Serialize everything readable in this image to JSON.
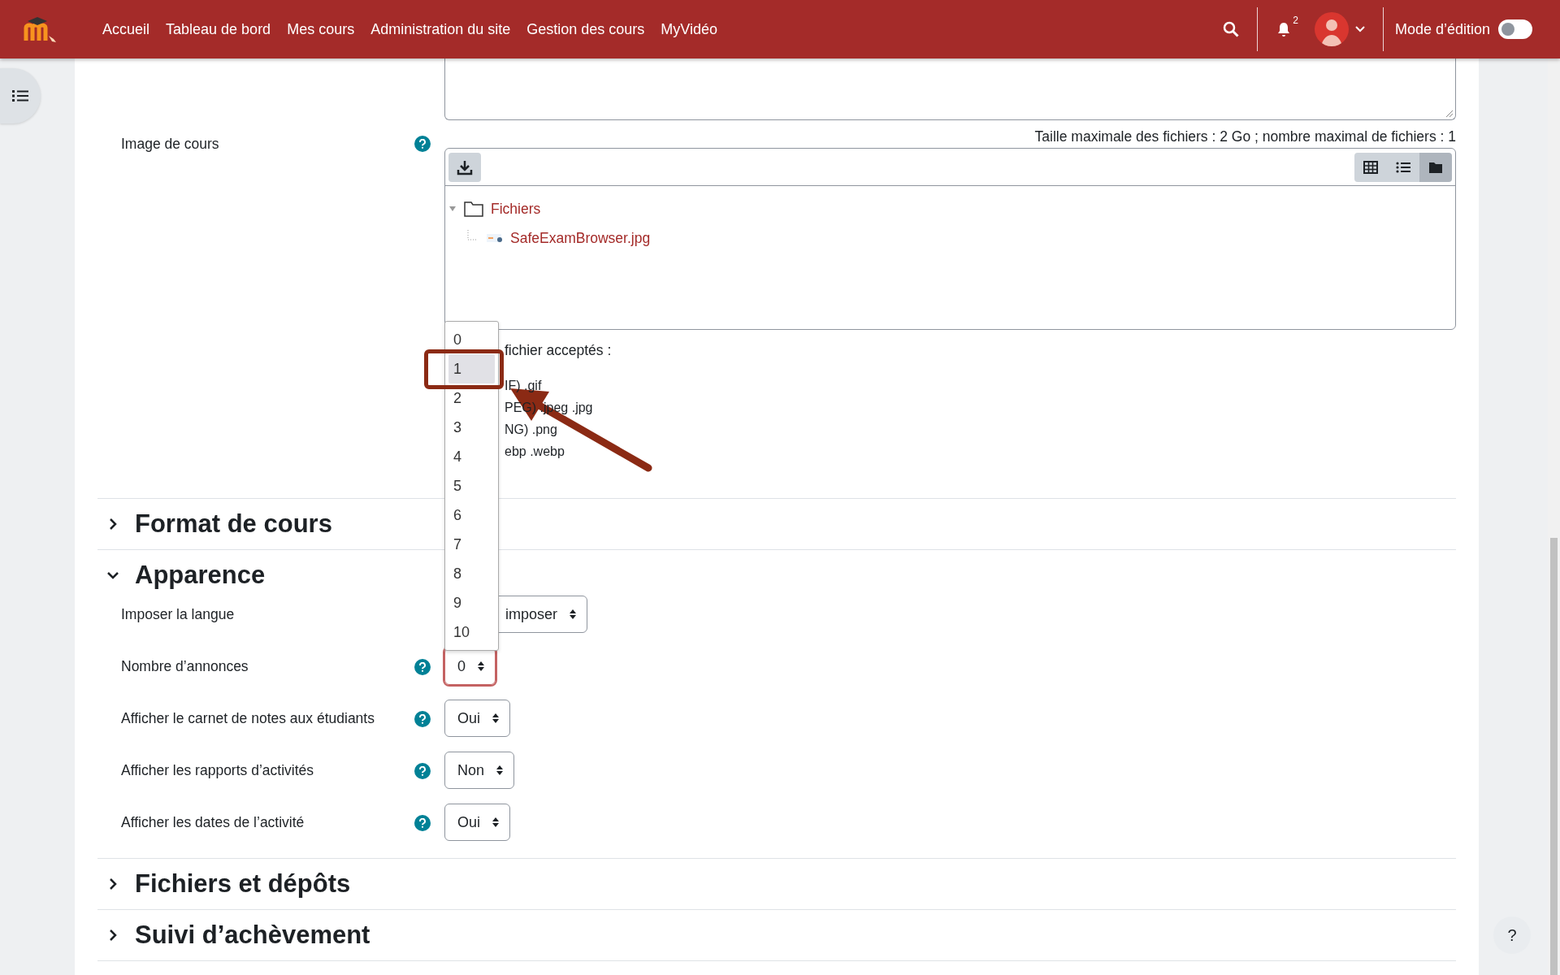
{
  "navbar": {
    "menu": [
      {
        "label": "Accueil"
      },
      {
        "label": "Tableau de bord"
      },
      {
        "label": "Mes cours"
      },
      {
        "label": "Administration du site"
      },
      {
        "label": "Gestion des cours"
      },
      {
        "label": "MyVidéo"
      }
    ],
    "notification_count": "2",
    "edit_mode": {
      "label": "Mode d’édition",
      "on": false
    }
  },
  "course_image": {
    "label": "Image de cours",
    "help": true,
    "max_info": "Taille maximale des fichiers : 2 Go ; nombre maximal de fichiers : 1",
    "views": [
      {
        "kind": "grid",
        "selected": false
      },
      {
        "kind": "list",
        "selected": false
      },
      {
        "kind": "tree",
        "selected": true
      }
    ],
    "tree": [
      {
        "name": "Fichiers",
        "expanded": true,
        "children": [
          {
            "name": "SafeExamBrowser.jpg"
          }
        ]
      }
    ],
    "accepted_types": [
      "fichier acceptés :",
      "IF) .gif",
      "PEG) .jpeg .jpg",
      "NG) .png",
      "ebp .webp"
    ]
  },
  "sections": [
    {
      "title": "Format de cours",
      "expanded": false
    },
    {
      "title": "Apparence",
      "expanded": true,
      "fields": [
        {
          "label": "Imposer la langue",
          "help": false,
          "value": "imposer",
          "focused": false
        },
        {
          "label": "Nombre d’annonces",
          "help": true,
          "value": "0",
          "focused": true
        },
        {
          "label": "Afficher le carnet de notes aux étudiants",
          "help": true,
          "value": "Oui",
          "focused": false
        },
        {
          "label": "Afficher les rapports d’activités",
          "help": true,
          "value": "Non",
          "focused": false
        },
        {
          "label": "Afficher les dates de l’activité",
          "help": true,
          "value": "Oui",
          "focused": false
        }
      ]
    },
    {
      "title": "Fichiers et dépôts",
      "expanded": false
    },
    {
      "title": "Suivi d’achèvement",
      "expanded": false
    }
  ],
  "dropdown": {
    "options": [
      {
        "label": "0",
        "selected": false
      },
      {
        "label": "1",
        "selected": true
      },
      {
        "label": "2",
        "selected": false
      },
      {
        "label": "3",
        "selected": false
      },
      {
        "label": "4",
        "selected": false
      },
      {
        "label": "5",
        "selected": false
      },
      {
        "label": "6",
        "selected": false
      },
      {
        "label": "7",
        "selected": false
      },
      {
        "label": "8",
        "selected": false
      },
      {
        "label": "9",
        "selected": false
      },
      {
        "label": "10",
        "selected": false
      }
    ]
  },
  "help_button": {
    "label": "?"
  }
}
